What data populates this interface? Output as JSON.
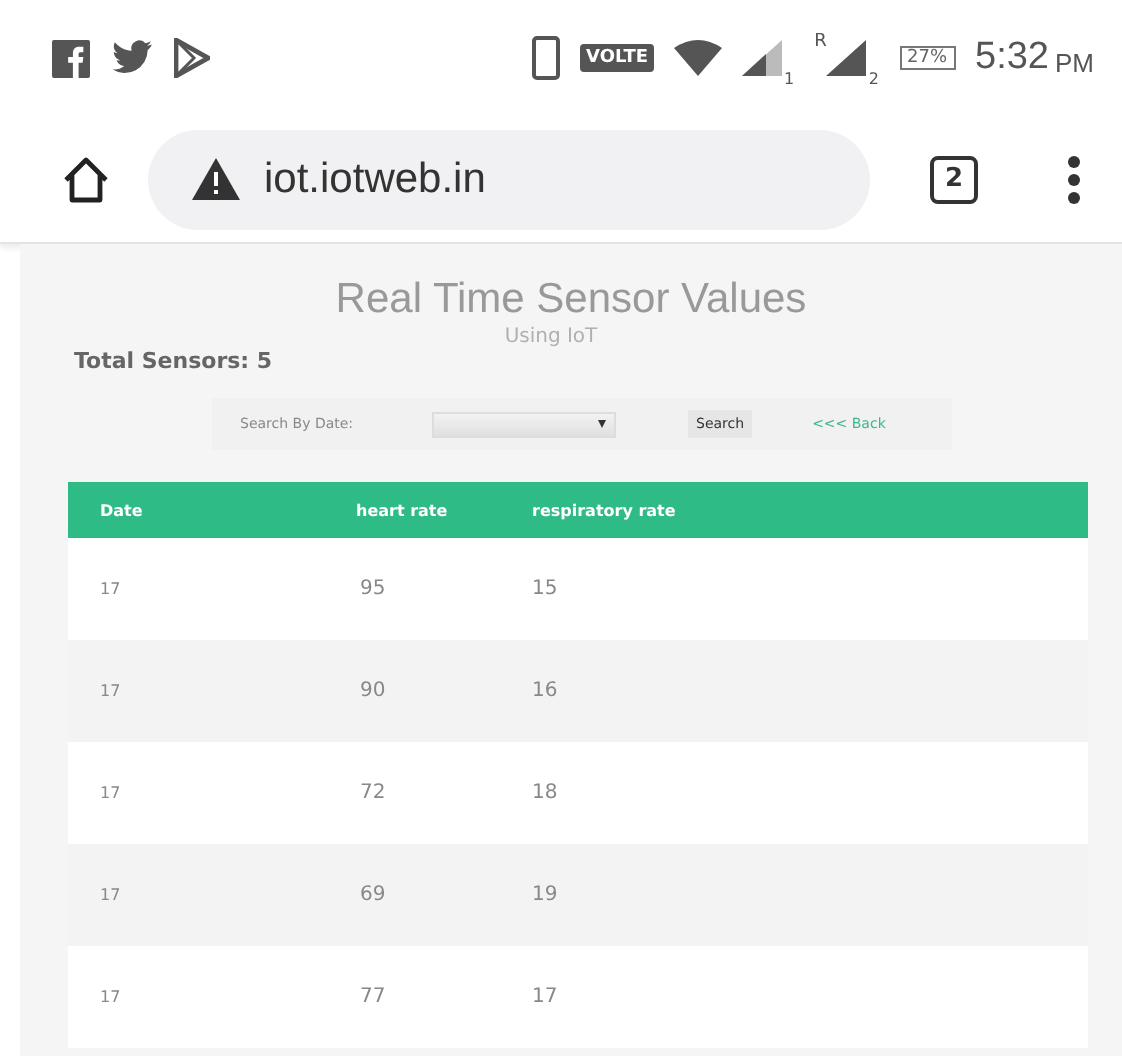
{
  "status_bar": {
    "volte": "VOLTE",
    "sim1": "1",
    "roaming": "R",
    "sim2": "2",
    "battery": "27%",
    "time": "5:32",
    "ampm": "PM"
  },
  "browser": {
    "url": "iot.iotweb.in",
    "tab_count": "2"
  },
  "page": {
    "title": "Real Time Sensor Values",
    "subtitle": "Using IoT",
    "total": "Total Sensors: 5",
    "search": {
      "label": "Search By Date:",
      "button": "Search",
      "back": "<<< Back"
    },
    "table": {
      "columns": [
        "Date",
        "heart rate",
        "respiratory rate"
      ],
      "rows": [
        [
          "17",
          "95",
          "15"
        ],
        [
          "17",
          "90",
          "16"
        ],
        [
          "17",
          "72",
          "18"
        ],
        [
          "17",
          "69",
          "19"
        ],
        [
          "17",
          "77",
          "17"
        ]
      ]
    }
  }
}
